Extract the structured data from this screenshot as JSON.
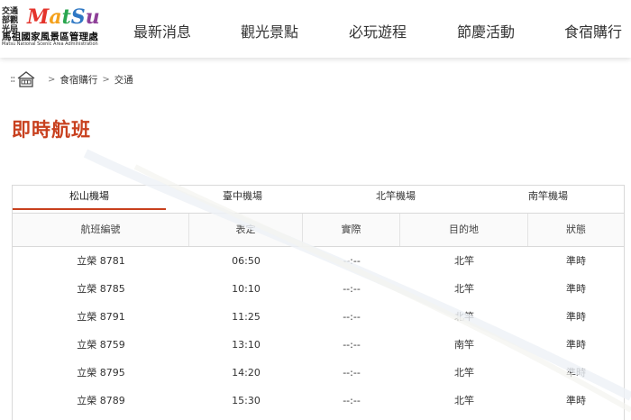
{
  "header": {
    "logo": {
      "agency": "交通部觀光局",
      "brand_letters": [
        {
          "ch": "M",
          "color": "#e4332b"
        },
        {
          "ch": "a",
          "color": "#f4a11c"
        },
        {
          "ch": "t",
          "color": "#2aa64f"
        },
        {
          "ch": "S",
          "color": "#2f78c4"
        },
        {
          "ch": "u",
          "color": "#8e3f98"
        }
      ],
      "name": "馬祖國家風景區管理處",
      "english": "Matsu National Scenic Area Administration"
    },
    "nav": [
      "最新消息",
      "觀光景點",
      "必玩遊程",
      "節慶活動",
      "食宿購行"
    ]
  },
  "breadcrumb": {
    "items": [
      "食宿購行",
      "交通"
    ]
  },
  "page_title": "即時航班",
  "accent_color": "#c8401e",
  "tabs": [
    {
      "label": "松山機場",
      "active": true
    },
    {
      "label": "臺中機場",
      "active": false
    },
    {
      "label": "北竿機場",
      "active": false
    },
    {
      "label": "南竿機場",
      "active": false
    }
  ],
  "table": {
    "headers": [
      "航班編號",
      "表定",
      "實際",
      "目的地",
      "狀態"
    ],
    "rows": [
      [
        "立榮 8781",
        "06:50",
        "--:--",
        "北竿",
        "準時"
      ],
      [
        "立榮 8785",
        "10:10",
        "--:--",
        "北竿",
        "準時"
      ],
      [
        "立榮 8791",
        "11:25",
        "--:--",
        "北竿",
        "準時"
      ],
      [
        "立榮 8759",
        "13:10",
        "--:--",
        "南竿",
        "準時"
      ],
      [
        "立榮 8795",
        "14:20",
        "--:--",
        "北竿",
        "準時"
      ],
      [
        "立榮 8789",
        "15:30",
        "--:--",
        "北竿",
        "準時"
      ]
    ]
  }
}
